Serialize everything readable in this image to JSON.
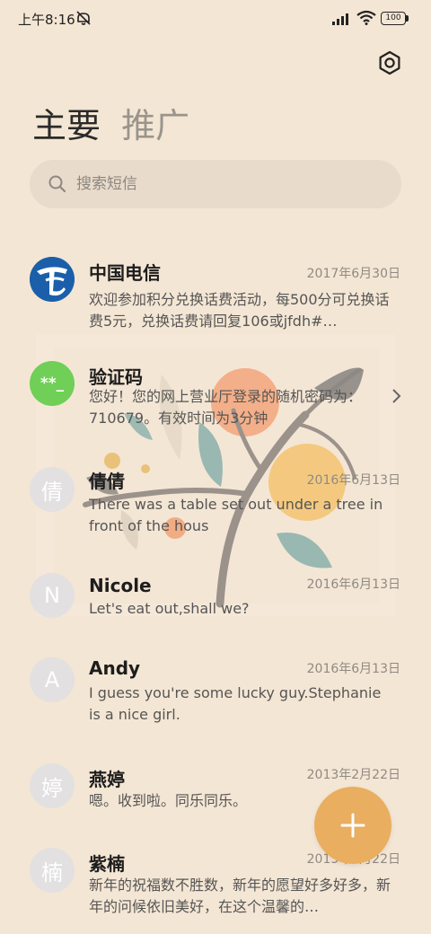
{
  "status_bar": {
    "time": "上午8:16",
    "battery": "100",
    "icons": [
      "mute-icon",
      "signal-icon",
      "wifi-icon",
      "battery-icon"
    ]
  },
  "header": {
    "settings_icon": "gear-icon"
  },
  "tabs": [
    {
      "label": "主要",
      "active": true
    },
    {
      "label": "推广",
      "active": false
    }
  ],
  "search": {
    "placeholder": "搜索短信",
    "value": ""
  },
  "colors": {
    "background": "#f4e6d4",
    "fab": "#e9ae5f",
    "verify_avatar": "#6fcf56",
    "telecom_blue": "#1b5faa"
  },
  "messages": [
    {
      "name": "中国电信",
      "date": "2017年6月30日",
      "preview": "欢迎参加积分兑换话费活动，每500分可兑换话费5元，兑换话费请回复106或jfdh#…",
      "avatar": "china-telecom-logo"
    },
    {
      "name": "验证码",
      "date": "",
      "preview": "您好！您的网上营业厅登录的随机密码为：710679。有效时间为3分钟",
      "avatar": "**_"
    },
    {
      "name": "倩倩",
      "date": "2016年6月13日",
      "preview": "There was a table set out under a tree in front of the hous",
      "avatar": "倩"
    },
    {
      "name": "Nicole",
      "date": "2016年6月13日",
      "preview": "Let's eat out,shall we?",
      "avatar": "N"
    },
    {
      "name": "Andy",
      "date": "2016年6月13日",
      "preview": "I guess you're some lucky guy.Stephanie is a nice girl.",
      "avatar": "A"
    },
    {
      "name": "燕婷",
      "date": "2013年2月22日",
      "preview": "嗯。收到啦。同乐同乐。",
      "avatar": "婷"
    },
    {
      "name": "紫楠",
      "date": "2013年2月22日",
      "preview": "新年的祝福数不胜数，新年的愿望好多好多，新年的问候依旧美好，在这个温馨的…",
      "avatar": "楠"
    }
  ],
  "fab": {
    "icon": "plus-icon"
  }
}
